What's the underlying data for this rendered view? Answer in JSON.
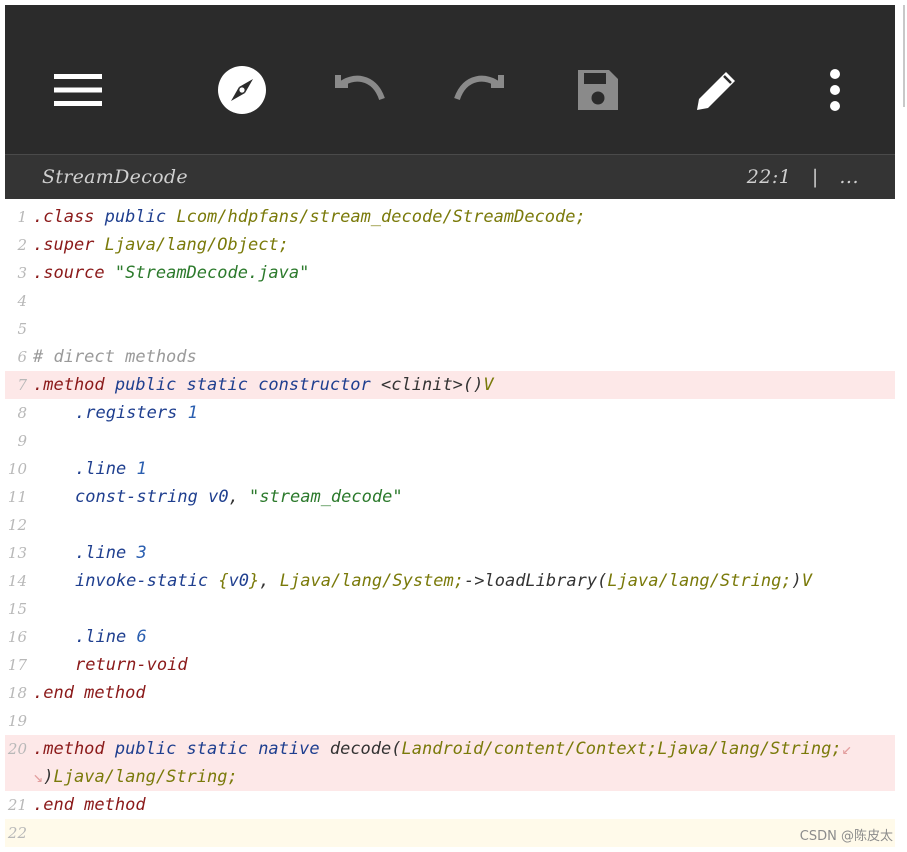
{
  "toolbar": {
    "icons": [
      "menu-icon",
      "compass-icon",
      "undo-icon",
      "redo-icon",
      "save-icon",
      "pencil-icon",
      "more-vertical-icon"
    ]
  },
  "editor_header": {
    "file_name": "StreamDecode",
    "cursor_position": "22:1",
    "separator": "|",
    "more": "..."
  },
  "code_lines": [
    {
      "num": "1",
      "tokens": [
        [
          "kw",
          ".class"
        ],
        [
          "plain",
          " "
        ],
        [
          "mod",
          "public"
        ],
        [
          "plain",
          " "
        ],
        [
          "type",
          "Lcom/hdpfans/stream_decode/StreamDecode;"
        ]
      ]
    },
    {
      "num": "2",
      "tokens": [
        [
          "kw",
          ".super"
        ],
        [
          "plain",
          " "
        ],
        [
          "type",
          "Ljava/lang/Object;"
        ]
      ]
    },
    {
      "num": "3",
      "tokens": [
        [
          "kw",
          ".source"
        ],
        [
          "plain",
          " "
        ],
        [
          "str",
          "\"StreamDecode.java\""
        ]
      ]
    },
    {
      "num": "4",
      "tokens": []
    },
    {
      "num": "5",
      "tokens": []
    },
    {
      "num": "6",
      "tokens": [
        [
          "cm",
          "# direct methods"
        ]
      ]
    },
    {
      "num": "7",
      "tokens": [
        [
          "kw",
          ".method"
        ],
        [
          "plain",
          " "
        ],
        [
          "mod",
          "public static constructor"
        ],
        [
          "plain",
          " "
        ],
        [
          "plain",
          "<clinit>()"
        ],
        [
          "type",
          "V"
        ]
      ]
    },
    {
      "num": "8",
      "indent": true,
      "tokens": [
        [
          "mod",
          ".registers"
        ],
        [
          "plain",
          " "
        ],
        [
          "num",
          "1"
        ]
      ]
    },
    {
      "num": "9",
      "tokens": []
    },
    {
      "num": "10",
      "indent": true,
      "tokens": [
        [
          "mod",
          ".line"
        ],
        [
          "plain",
          " "
        ],
        [
          "num",
          "1"
        ]
      ]
    },
    {
      "num": "11",
      "indent": true,
      "tokens": [
        [
          "mod",
          "const-string"
        ],
        [
          "plain",
          " "
        ],
        [
          "reg",
          "v0"
        ],
        [
          "plain",
          ", "
        ],
        [
          "str",
          "\"stream_decode\""
        ]
      ]
    },
    {
      "num": "12",
      "tokens": []
    },
    {
      "num": "13",
      "indent": true,
      "tokens": [
        [
          "mod",
          ".line"
        ],
        [
          "plain",
          " "
        ],
        [
          "num",
          "3"
        ]
      ]
    },
    {
      "num": "14",
      "indent": true,
      "tokens": [
        [
          "mod",
          "invoke-static"
        ],
        [
          "plain",
          " "
        ],
        [
          "type",
          "{"
        ],
        [
          "reg",
          "v0"
        ],
        [
          "type",
          "}"
        ],
        [
          "plain",
          ", "
        ],
        [
          "type",
          "Ljava/lang/System;"
        ],
        [
          "plain",
          "->loadLibrary("
        ],
        [
          "type",
          "Ljava/lang/String;"
        ],
        [
          "plain",
          ")"
        ],
        [
          "type",
          "V"
        ]
      ]
    },
    {
      "num": "15",
      "tokens": []
    },
    {
      "num": "16",
      "indent": true,
      "tokens": [
        [
          "mod",
          ".line"
        ],
        [
          "plain",
          " "
        ],
        [
          "num",
          "6"
        ]
      ]
    },
    {
      "num": "17",
      "indent": true,
      "tokens": [
        [
          "kw",
          "return-void"
        ]
      ]
    },
    {
      "num": "18",
      "tokens": [
        [
          "kw",
          ".end method"
        ]
      ]
    },
    {
      "num": "19",
      "tokens": []
    },
    {
      "num": "20",
      "tokens": [
        [
          "kw",
          ".method"
        ],
        [
          "plain",
          " "
        ],
        [
          "mod",
          "public static native"
        ],
        [
          "plain",
          " decode("
        ],
        [
          "type",
          "Landroid/content/Context;Ljava/lang/String;"
        ],
        [
          "wrap",
          "↙"
        ]
      ]
    },
    {
      "num": "",
      "tokens": [
        [
          "wrap",
          "↘"
        ],
        [
          "plain",
          ")"
        ],
        [
          "type",
          "Ljava/lang/String;"
        ]
      ]
    },
    {
      "num": "21",
      "tokens": [
        [
          "kw",
          ".end method"
        ]
      ]
    },
    {
      "num": "22",
      "tokens": []
    }
  ],
  "watermark": "CSDN @陈皮太"
}
